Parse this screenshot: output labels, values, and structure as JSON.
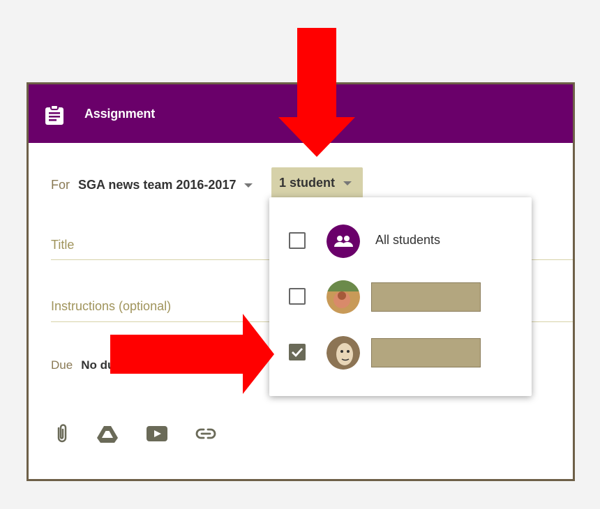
{
  "assignment_card": {
    "header_title": "Assignment",
    "for_label": "For",
    "class_name": "SGA news team 2016-2017",
    "students_button_label": "1 student",
    "title_placeholder": "Title",
    "instructions_placeholder": "Instructions (optional)",
    "due_label": "Due",
    "due_value": "No du"
  },
  "student_dropdown": {
    "items": [
      {
        "label": "All students",
        "checked": false
      },
      {
        "label": "",
        "checked": false
      },
      {
        "label": "",
        "checked": true
      }
    ]
  },
  "toolbar_icons": [
    "attach-icon",
    "google-drive-icon",
    "youtube-icon",
    "link-icon"
  ],
  "colors": {
    "header": "#6a006a",
    "accent": "#d6d1a9",
    "arrows": "#ff0000",
    "redaction": "#b3a67f"
  }
}
